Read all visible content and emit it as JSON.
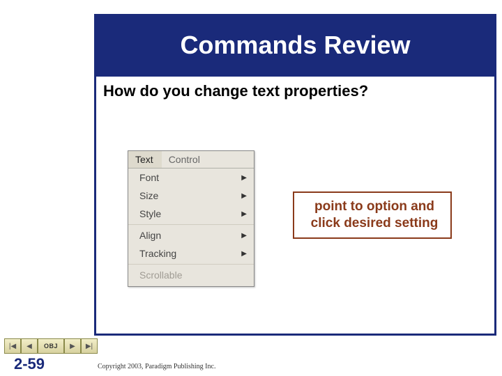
{
  "title": "Commands Review",
  "question": "How do you change text properties?",
  "menu": {
    "tabs": [
      {
        "label": "Text",
        "active": true
      },
      {
        "label": "Control",
        "active": false
      }
    ],
    "items_group1": [
      {
        "label": "Font"
      },
      {
        "label": "Size"
      },
      {
        "label": "Style"
      }
    ],
    "items_group2": [
      {
        "label": "Align"
      },
      {
        "label": "Tracking"
      }
    ],
    "disabled": "Scrollable"
  },
  "callout": "point to option and click desired setting",
  "nav": {
    "prev_icon": "◀",
    "prev_bar_icon": "|◀",
    "obj_label": "OBJ",
    "next_bar_icon": "▶|",
    "next_icon": "▶"
  },
  "slide_number": "2-59",
  "copyright": "Copyright 2003, Paradigm Publishing Inc."
}
